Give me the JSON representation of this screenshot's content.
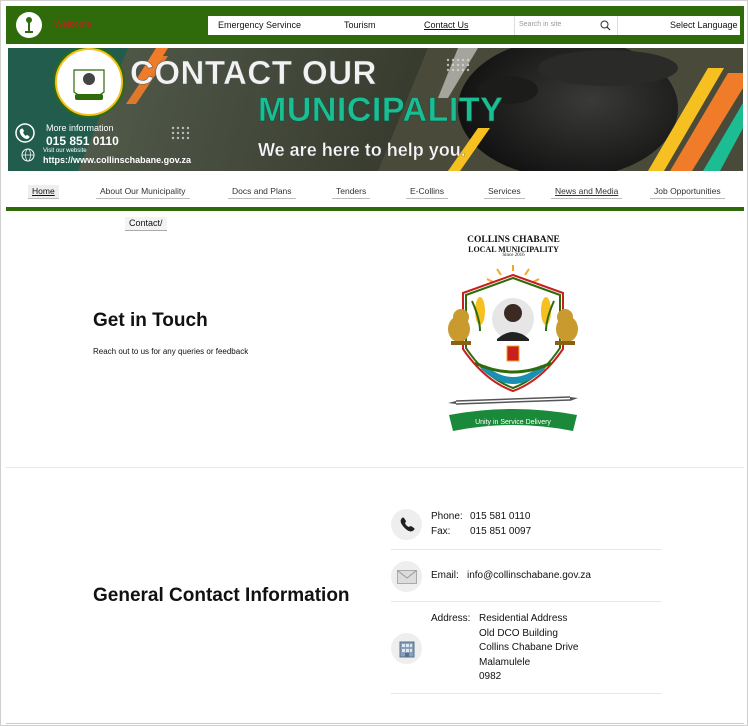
{
  "topbar": {
    "red_text": "Welcome",
    "links": [
      "Emergency Servince",
      "Tourism",
      "Contact Us"
    ],
    "search_placeholder": "Search in site",
    "language_label": "Select Language"
  },
  "banner": {
    "title_line1": "CONTACT OUR",
    "title_line2": "MUNICIPALITY",
    "subtitle": "We are here to help you.",
    "more_info": "More information",
    "phone": "015 851 0110",
    "visit": "Visit our website",
    "url": "https://www.collinschabane.gov.za"
  },
  "mainnav": {
    "items": [
      "Home",
      "About Our Municipality",
      "Docs and Plans",
      "Tenders",
      "E-Collins",
      "Services",
      "News and Media",
      "Job Opportunities"
    ],
    "active": "Home"
  },
  "breadcrumb": {
    "current": "Contact/"
  },
  "get_in_touch": {
    "title": "Get in Touch",
    "subtitle": "Reach out to us for any queries or feedback"
  },
  "crest": {
    "line1": "COLLINS CHABANE",
    "line2": "LOCAL MUNICIPALITY",
    "line3": "Since 2016",
    "motto": "Unity in Service Delivery"
  },
  "general_contact": {
    "title": "General Contact Information",
    "phone_label": "Phone:",
    "phone_value": "015 581 0110",
    "fax_label": "Fax:",
    "fax_value": "015 851 0097",
    "email_label": "Email:",
    "email_value": "info@collinschabane.gov.za",
    "address_label": "Address:",
    "address_lines": [
      "Residential Address",
      "Old DCO Building",
      "Collins Chabane Drive",
      "Malamulele",
      "0982"
    ]
  },
  "colors": {
    "brand_green": "#2f6b0a",
    "banner_teal": "#1dbd93",
    "accent_orange": "#f07c2a",
    "accent_red": "#c8201f"
  },
  "icons": [
    "logo-icon",
    "search-icon",
    "phone-icon",
    "mail-icon",
    "building-icon",
    "globe-icon"
  ]
}
